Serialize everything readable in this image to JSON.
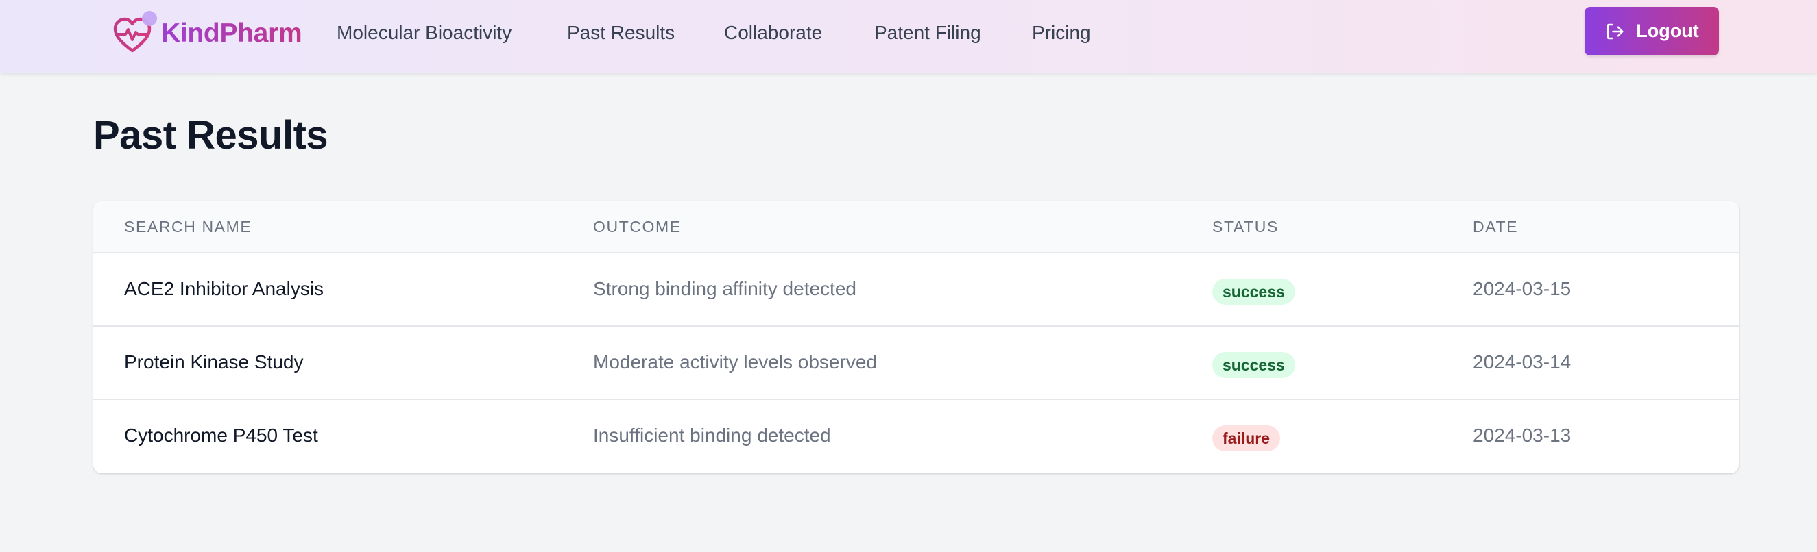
{
  "header": {
    "brand": "KindPharm",
    "nav": [
      {
        "label": "Molecular Bioactivity"
      },
      {
        "label": "Past Results"
      },
      {
        "label": "Collaborate"
      },
      {
        "label": "Patent Filing"
      },
      {
        "label": "Pricing"
      }
    ],
    "logout_label": "Logout"
  },
  "page": {
    "title": "Past Results"
  },
  "table": {
    "columns": [
      "SEARCH NAME",
      "OUTCOME",
      "STATUS",
      "DATE"
    ],
    "rows": [
      {
        "name": "ACE2 Inhibitor Analysis",
        "outcome": "Strong binding affinity detected",
        "status": "success",
        "date": "2024-03-15"
      },
      {
        "name": "Protein Kinase Study",
        "outcome": "Moderate activity levels observed",
        "status": "success",
        "date": "2024-03-14"
      },
      {
        "name": "Cytochrome P450 Test",
        "outcome": "Insufficient binding detected",
        "status": "failure",
        "date": "2024-03-13"
      }
    ]
  },
  "colors": {
    "brand_start": "#9e3fd0",
    "brand_end": "#c0398a",
    "success_bg": "#dcfce7",
    "success_text": "#166534",
    "failure_bg": "#fee2e2",
    "failure_text": "#991b1b"
  },
  "icons": {
    "logo": "heart-pulse-icon",
    "logout": "logout-icon"
  }
}
